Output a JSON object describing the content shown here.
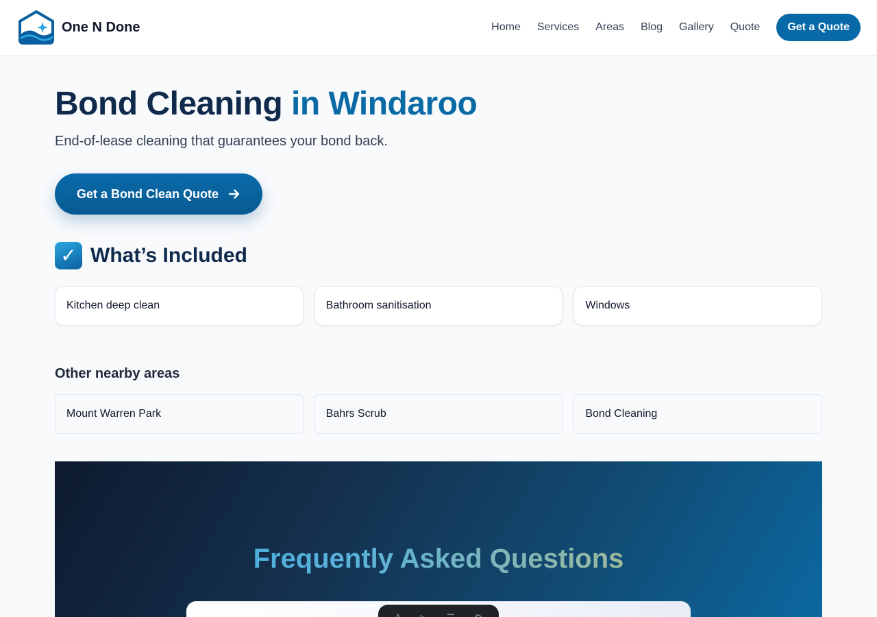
{
  "brand": {
    "name": "One N Done"
  },
  "nav": {
    "links": [
      "Home",
      "Services",
      "Areas",
      "Blog",
      "Gallery",
      "Quote"
    ],
    "cta_label": "Get a Quote"
  },
  "hero": {
    "title_main": "Bond Cleaning ",
    "title_accent": "in Windaroo",
    "subtitle": "End-of-lease cleaning that guarantees your bond back.",
    "cta_label": "Get a Bond Clean Quote",
    "cta_icon": "arrow-right-icon"
  },
  "included": {
    "check_glyph": "✓",
    "title": "What’s Included",
    "items": [
      "Kitchen deep clean",
      "Bathroom sanitisation",
      "Windows"
    ]
  },
  "nearby": {
    "title": "Other nearby areas",
    "items": [
      "Mount Warren Park",
      "Bahrs Scrub",
      "Bond Cleaning"
    ]
  },
  "faq": {
    "title": "Frequently Asked Questions"
  },
  "colors": {
    "primary": "#0769a8",
    "heading_dark": "#102a4c",
    "page_bg": "#f8fafc"
  }
}
